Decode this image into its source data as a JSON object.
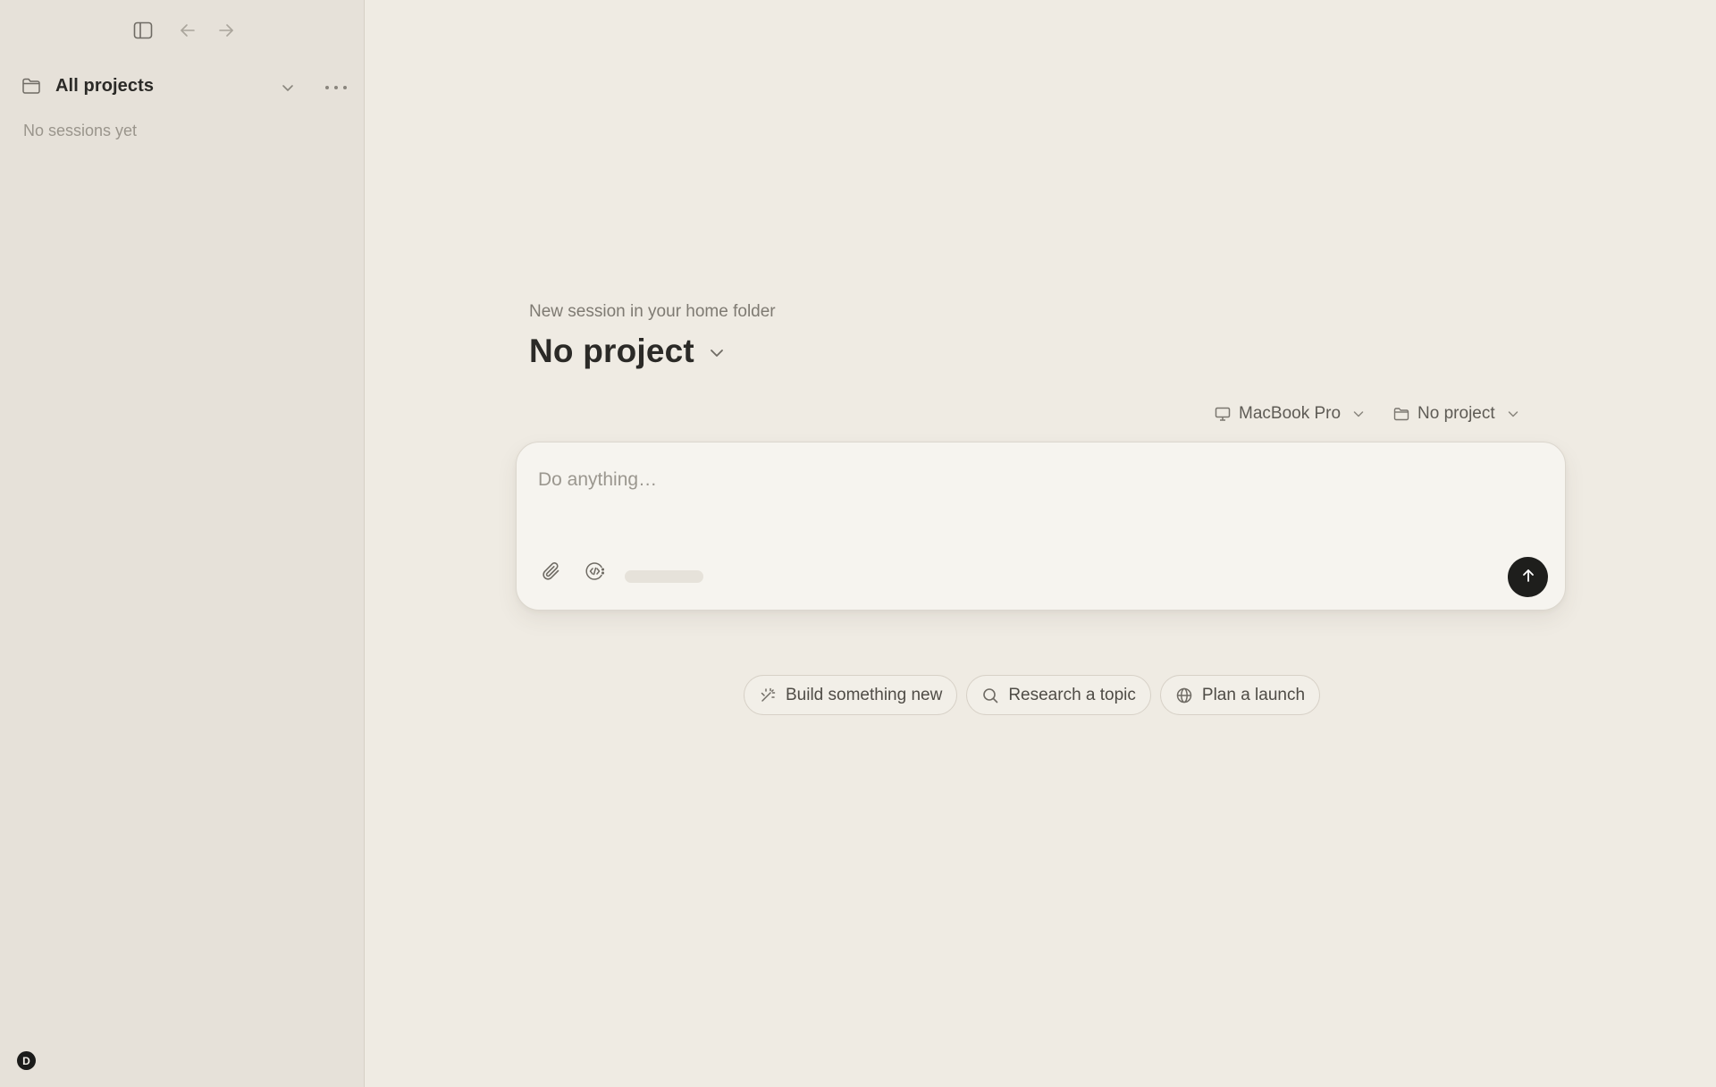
{
  "sidebar": {
    "project_title": "All projects",
    "empty_text": "No sessions yet",
    "user_initial": "D"
  },
  "main": {
    "subtitle": "New session in your home folder",
    "heading": "No project",
    "selectors": {
      "device": "MacBook Pro",
      "project": "No project"
    },
    "composer": {
      "placeholder": "Do anything…"
    },
    "suggestions": [
      {
        "label": "Build something new",
        "icon": "magic-wand-icon"
      },
      {
        "label": "Research a topic",
        "icon": "search-icon"
      },
      {
        "label": "Plan a launch",
        "icon": "globe-icon"
      }
    ]
  },
  "colors": {
    "background": "#efebe3",
    "sidebar": "#e6e1d9",
    "send_button": "#1e1e1c"
  }
}
